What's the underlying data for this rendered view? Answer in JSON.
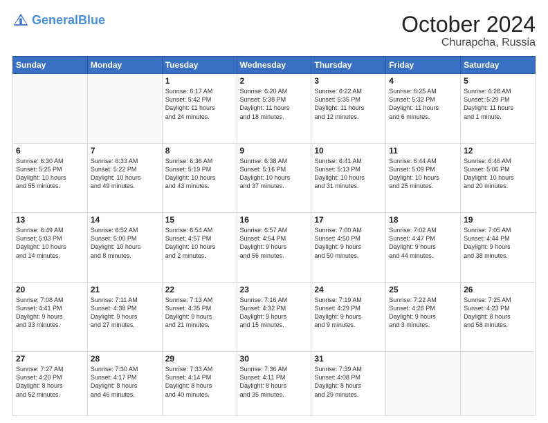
{
  "header": {
    "logo_line1": "General",
    "logo_line2": "Blue",
    "month": "October 2024",
    "location": "Churapcha, Russia"
  },
  "weekdays": [
    "Sunday",
    "Monday",
    "Tuesday",
    "Wednesday",
    "Thursday",
    "Friday",
    "Saturday"
  ],
  "rows": [
    [
      {
        "day": "",
        "lines": []
      },
      {
        "day": "",
        "lines": []
      },
      {
        "day": "1",
        "lines": [
          "Sunrise: 6:17 AM",
          "Sunset: 5:42 PM",
          "Daylight: 11 hours",
          "and 24 minutes."
        ]
      },
      {
        "day": "2",
        "lines": [
          "Sunrise: 6:20 AM",
          "Sunset: 5:38 PM",
          "Daylight: 11 hours",
          "and 18 minutes."
        ]
      },
      {
        "day": "3",
        "lines": [
          "Sunrise: 6:22 AM",
          "Sunset: 5:35 PM",
          "Daylight: 11 hours",
          "and 12 minutes."
        ]
      },
      {
        "day": "4",
        "lines": [
          "Sunrise: 6:25 AM",
          "Sunset: 5:32 PM",
          "Daylight: 11 hours",
          "and 6 minutes."
        ]
      },
      {
        "day": "5",
        "lines": [
          "Sunrise: 6:28 AM",
          "Sunset: 5:29 PM",
          "Daylight: 11 hours",
          "and 1 minute."
        ]
      }
    ],
    [
      {
        "day": "6",
        "lines": [
          "Sunrise: 6:30 AM",
          "Sunset: 5:25 PM",
          "Daylight: 10 hours",
          "and 55 minutes."
        ]
      },
      {
        "day": "7",
        "lines": [
          "Sunrise: 6:33 AM",
          "Sunset: 5:22 PM",
          "Daylight: 10 hours",
          "and 49 minutes."
        ]
      },
      {
        "day": "8",
        "lines": [
          "Sunrise: 6:36 AM",
          "Sunset: 5:19 PM",
          "Daylight: 10 hours",
          "and 43 minutes."
        ]
      },
      {
        "day": "9",
        "lines": [
          "Sunrise: 6:38 AM",
          "Sunset: 5:16 PM",
          "Daylight: 10 hours",
          "and 37 minutes."
        ]
      },
      {
        "day": "10",
        "lines": [
          "Sunrise: 6:41 AM",
          "Sunset: 5:13 PM",
          "Daylight: 10 hours",
          "and 31 minutes."
        ]
      },
      {
        "day": "11",
        "lines": [
          "Sunrise: 6:44 AM",
          "Sunset: 5:09 PM",
          "Daylight: 10 hours",
          "and 25 minutes."
        ]
      },
      {
        "day": "12",
        "lines": [
          "Sunrise: 6:46 AM",
          "Sunset: 5:06 PM",
          "Daylight: 10 hours",
          "and 20 minutes."
        ]
      }
    ],
    [
      {
        "day": "13",
        "lines": [
          "Sunrise: 6:49 AM",
          "Sunset: 5:03 PM",
          "Daylight: 10 hours",
          "and 14 minutes."
        ]
      },
      {
        "day": "14",
        "lines": [
          "Sunrise: 6:52 AM",
          "Sunset: 5:00 PM",
          "Daylight: 10 hours",
          "and 8 minutes."
        ]
      },
      {
        "day": "15",
        "lines": [
          "Sunrise: 6:54 AM",
          "Sunset: 4:57 PM",
          "Daylight: 10 hours",
          "and 2 minutes."
        ]
      },
      {
        "day": "16",
        "lines": [
          "Sunrise: 6:57 AM",
          "Sunset: 4:54 PM",
          "Daylight: 9 hours",
          "and 56 minutes."
        ]
      },
      {
        "day": "17",
        "lines": [
          "Sunrise: 7:00 AM",
          "Sunset: 4:50 PM",
          "Daylight: 9 hours",
          "and 50 minutes."
        ]
      },
      {
        "day": "18",
        "lines": [
          "Sunrise: 7:02 AM",
          "Sunset: 4:47 PM",
          "Daylight: 9 hours",
          "and 44 minutes."
        ]
      },
      {
        "day": "19",
        "lines": [
          "Sunrise: 7:05 AM",
          "Sunset: 4:44 PM",
          "Daylight: 9 hours",
          "and 38 minutes."
        ]
      }
    ],
    [
      {
        "day": "20",
        "lines": [
          "Sunrise: 7:08 AM",
          "Sunset: 4:41 PM",
          "Daylight: 9 hours",
          "and 33 minutes."
        ]
      },
      {
        "day": "21",
        "lines": [
          "Sunrise: 7:11 AM",
          "Sunset: 4:38 PM",
          "Daylight: 9 hours",
          "and 27 minutes."
        ]
      },
      {
        "day": "22",
        "lines": [
          "Sunrise: 7:13 AM",
          "Sunset: 4:35 PM",
          "Daylight: 9 hours",
          "and 21 minutes."
        ]
      },
      {
        "day": "23",
        "lines": [
          "Sunrise: 7:16 AM",
          "Sunset: 4:32 PM",
          "Daylight: 9 hours",
          "and 15 minutes."
        ]
      },
      {
        "day": "24",
        "lines": [
          "Sunrise: 7:19 AM",
          "Sunset: 4:29 PM",
          "Daylight: 9 hours",
          "and 9 minutes."
        ]
      },
      {
        "day": "25",
        "lines": [
          "Sunrise: 7:22 AM",
          "Sunset: 4:26 PM",
          "Daylight: 9 hours",
          "and 3 minutes."
        ]
      },
      {
        "day": "26",
        "lines": [
          "Sunrise: 7:25 AM",
          "Sunset: 4:23 PM",
          "Daylight: 8 hours",
          "and 58 minutes."
        ]
      }
    ],
    [
      {
        "day": "27",
        "lines": [
          "Sunrise: 7:27 AM",
          "Sunset: 4:20 PM",
          "Daylight: 8 hours",
          "and 52 minutes."
        ]
      },
      {
        "day": "28",
        "lines": [
          "Sunrise: 7:30 AM",
          "Sunset: 4:17 PM",
          "Daylight: 8 hours",
          "and 46 minutes."
        ]
      },
      {
        "day": "29",
        "lines": [
          "Sunrise: 7:33 AM",
          "Sunset: 4:14 PM",
          "Daylight: 8 hours",
          "and 40 minutes."
        ]
      },
      {
        "day": "30",
        "lines": [
          "Sunrise: 7:36 AM",
          "Sunset: 4:11 PM",
          "Daylight: 8 hours",
          "and 35 minutes."
        ]
      },
      {
        "day": "31",
        "lines": [
          "Sunrise: 7:39 AM",
          "Sunset: 4:08 PM",
          "Daylight: 8 hours",
          "and 29 minutes."
        ]
      },
      {
        "day": "",
        "lines": []
      },
      {
        "day": "",
        "lines": []
      }
    ]
  ]
}
